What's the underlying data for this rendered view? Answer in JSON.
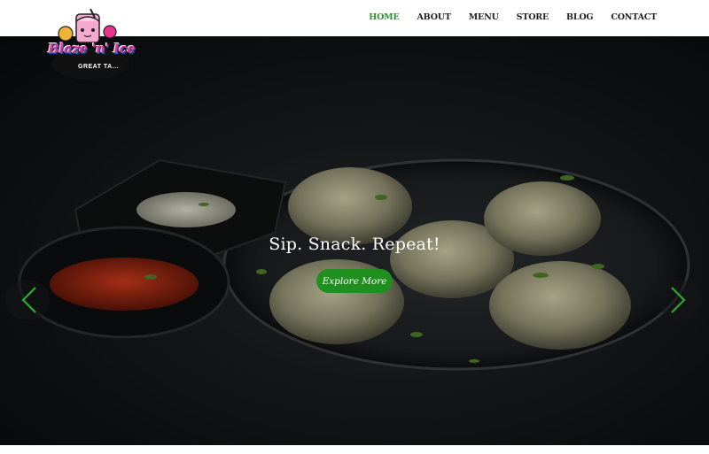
{
  "brand": {
    "name": "Blaze 'n' Ice",
    "tagline": "GREAT TA..."
  },
  "nav": {
    "items": [
      {
        "label": "HOME",
        "active": true
      },
      {
        "label": "ABOUT",
        "active": false
      },
      {
        "label": "MENU",
        "active": false
      },
      {
        "label": "STORE",
        "active": false
      },
      {
        "label": "BLOG",
        "active": false
      },
      {
        "label": "CONTACT",
        "active": false
      }
    ]
  },
  "hero": {
    "caption": "Sip. Snack. Repeat!",
    "cta_label": "Explore More",
    "prev_icon": "chevron-left-icon",
    "next_icon": "chevron-right-icon"
  },
  "colors": {
    "accent": "#2e8b2e",
    "cta": "#1f8f1f",
    "brand_pink": "#e8338f",
    "brand_blue": "#0a4fb3"
  }
}
